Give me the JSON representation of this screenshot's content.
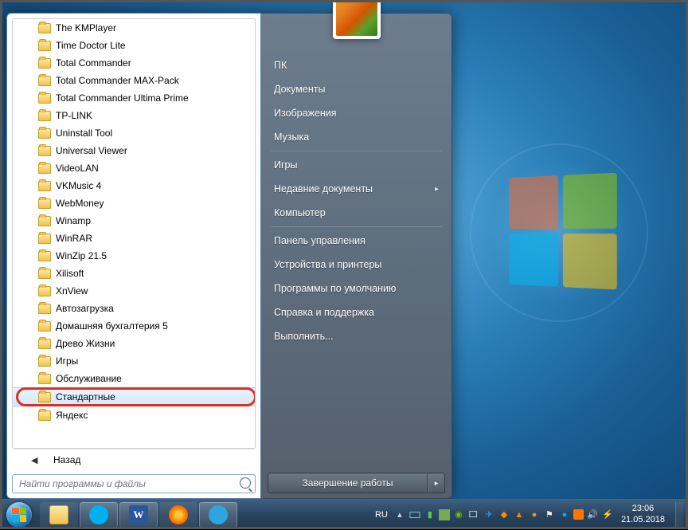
{
  "programs": [
    {
      "label": "The KMPlayer"
    },
    {
      "label": "Time Doctor Lite"
    },
    {
      "label": "Total Commander"
    },
    {
      "label": "Total Commander MAX-Pack"
    },
    {
      "label": "Total Commander Ultima Prime"
    },
    {
      "label": "TP-LINK"
    },
    {
      "label": "Uninstall Tool"
    },
    {
      "label": "Universal Viewer"
    },
    {
      "label": "VideoLAN"
    },
    {
      "label": "VKMusic 4"
    },
    {
      "label": "WebMoney"
    },
    {
      "label": "Winamp"
    },
    {
      "label": "WinRAR"
    },
    {
      "label": "WinZip 21.5"
    },
    {
      "label": "Xilisoft"
    },
    {
      "label": "XnView"
    },
    {
      "label": "Автозагрузка"
    },
    {
      "label": "Домашняя бухгалтерия 5"
    },
    {
      "label": "Древо Жизни"
    },
    {
      "label": "Игры"
    },
    {
      "label": "Обслуживание"
    },
    {
      "label": "Стандартные",
      "highlight": true
    },
    {
      "label": "Яндекс"
    }
  ],
  "back_label": "Назад",
  "search": {
    "placeholder": "Найти программы и файлы"
  },
  "right_menu": {
    "user": "ПК",
    "documents": "Документы",
    "pictures": "Изображения",
    "music": "Музыка",
    "games": "Игры",
    "recent": "Недавние документы",
    "computer": "Компьютер",
    "control_panel": "Панель управления",
    "devices": "Устройства и принтеры",
    "defaults": "Программы по умолчанию",
    "help": "Справка и поддержка",
    "run": "Выполнить..."
  },
  "shutdown_label": "Завершение работы",
  "taskbar": {
    "lang": "RU",
    "time": "23:06",
    "date": "21.05.2018"
  },
  "tray_icons": [
    "up-arrow",
    "keyboard",
    "bars",
    "album",
    "nvidia",
    "network",
    "telegram",
    "action",
    "fire",
    "fire2",
    "flag",
    "skype",
    "orange",
    "speaker",
    "power"
  ]
}
